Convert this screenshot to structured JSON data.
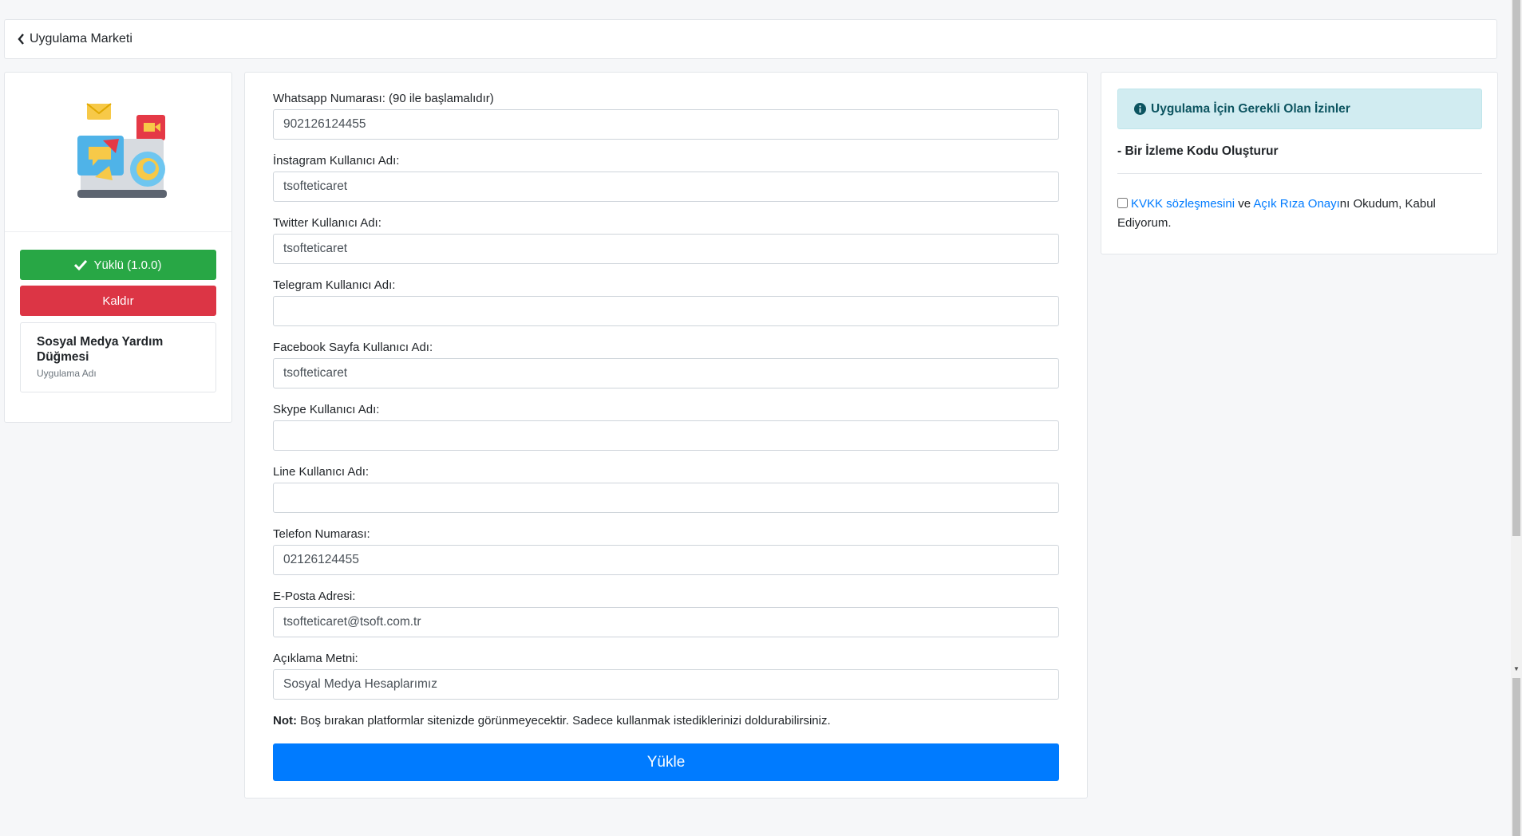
{
  "nav": {
    "back_label": "Uygulama Marketi"
  },
  "app": {
    "installed_label": "Yüklü (1.0.0)",
    "remove_label": "Kaldır",
    "name": "Sosyal Medya Yardım Düğmesi",
    "name_caption": "Uygulama Adı"
  },
  "form": {
    "fields": [
      {
        "label": "Whatsapp Numarası: (90 ile başlamalıdır)",
        "value": "902126124455"
      },
      {
        "label": "İnstagram Kullanıcı Adı:",
        "value": "tsofteticaret"
      },
      {
        "label": "Twitter Kullanıcı Adı:",
        "value": "tsofteticaret"
      },
      {
        "label": "Telegram Kullanıcı Adı:",
        "value": ""
      },
      {
        "label": "Facebook Sayfa Kullanıcı Adı:",
        "value": "tsofteticaret"
      },
      {
        "label": "Skype Kullanıcı Adı:",
        "value": ""
      },
      {
        "label": "Line Kullanıcı Adı:",
        "value": ""
      },
      {
        "label": "Telefon Numarası:",
        "value": "02126124455"
      },
      {
        "label": "E-Posta Adresi:",
        "value": "tsofteticaret@tsoft.com.tr"
      },
      {
        "label": "Açıklama Metni:",
        "value": "Sosyal Medya Hesaplarımız"
      }
    ],
    "note_bold": "Not:",
    "note_text": " Boş bırakan platformlar sitenizde görünmeyecektir. Sadece kullanmak istediklerinizi doldurabilirsiniz.",
    "submit_label": "Yükle"
  },
  "permissions": {
    "title": "Uygulama İçin Gerekli Olan İzinler",
    "items": [
      "- Bir İzleme Kodu Oluşturur"
    ],
    "consent": {
      "link1": "KVKK sözleşmesini",
      "mid": " ve ",
      "link2": "Açık Rıza Onayı",
      "tail": "nı Okudum, Kabul Ediyorum."
    }
  },
  "colors": {
    "success": "#28a745",
    "danger": "#dc3545",
    "primary": "#007bff",
    "info_bg": "#d1ecf1"
  }
}
